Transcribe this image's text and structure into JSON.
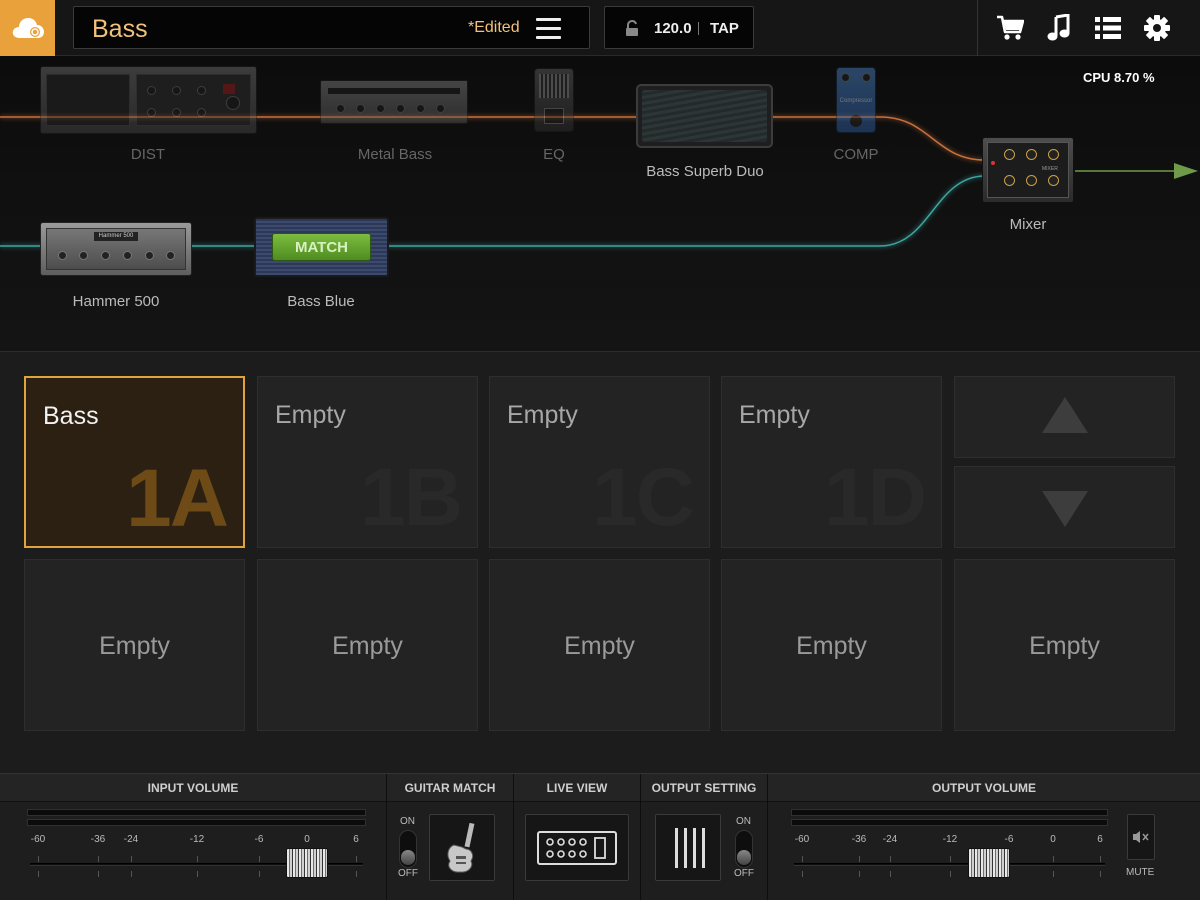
{
  "header": {
    "preset_name": "Bass",
    "edited_flag": "*Edited",
    "tempo": "120.0",
    "tap_label": "TAP",
    "accent_color": "#e9a23b",
    "icons": [
      "cloud-icon",
      "menu-icon",
      "lock-icon",
      "cart-icon",
      "music-note-icon",
      "list-icon",
      "gear-icon"
    ]
  },
  "chain": {
    "cpu": "CPU 8.70 %",
    "top_row": [
      {
        "label": "DIST",
        "state": "off"
      },
      {
        "label": "Metal Bass",
        "state": "off"
      },
      {
        "label": "EQ",
        "state": "off"
      },
      {
        "label": "Bass Superb Duo",
        "state": "on"
      },
      {
        "label": "COMP",
        "state": "off"
      }
    ],
    "bottom_row": [
      {
        "label": "Hammer 500",
        "state": "on",
        "faceplate": "Hammer 500"
      },
      {
        "label": "Bass Blue",
        "state": "on",
        "badge": "MATCH"
      }
    ],
    "mixer_label": "Mixer",
    "mixer_faceplate": "MIXER",
    "comp_faceplate": "Compressor",
    "top_line_color": "#c8703a",
    "bottom_line_color": "#3aa6a0",
    "output_line_color": "#6f9a4a"
  },
  "grid": {
    "row1": [
      {
        "name": "Bass",
        "id": "1A",
        "active": true
      },
      {
        "name": "Empty",
        "id": "1B",
        "active": false
      },
      {
        "name": "Empty",
        "id": "1C",
        "active": false
      },
      {
        "name": "Empty",
        "id": "1D",
        "active": false
      }
    ],
    "row2": [
      "Empty",
      "Empty",
      "Empty",
      "Empty",
      "Empty"
    ]
  },
  "bottom": {
    "input_volume": {
      "title": "INPUT VOLUME",
      "scale": [
        "-60",
        "-36",
        "-24",
        "-12",
        "-6",
        "0",
        "6"
      ]
    },
    "guitar_match": {
      "title": "GUITAR MATCH",
      "on": "ON",
      "off": "OFF"
    },
    "live_view": {
      "title": "LIVE VIEW"
    },
    "output_setting": {
      "title": "OUTPUT SETTING",
      "on": "ON",
      "off": "OFF"
    },
    "output_volume": {
      "title": "OUTPUT VOLUME",
      "scale": [
        "-60",
        "-36",
        "-24",
        "-12",
        "-6",
        "0",
        "6"
      ],
      "mute": "MUTE"
    }
  }
}
